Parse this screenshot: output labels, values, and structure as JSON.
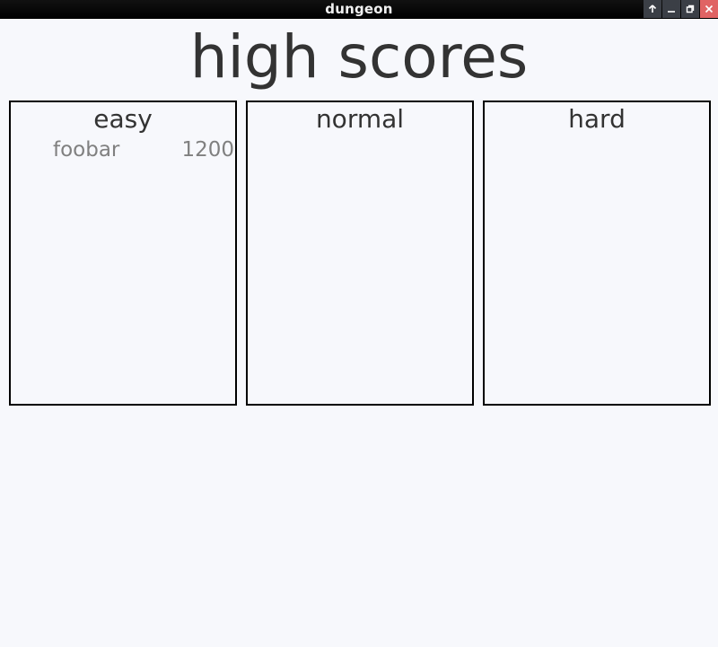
{
  "window": {
    "title": "dungeon",
    "buttons": [
      {
        "name": "raise",
        "icon": "arrow-up-icon"
      },
      {
        "name": "minimize",
        "icon": "minimize-icon"
      },
      {
        "name": "maximize",
        "icon": "restore-icon"
      },
      {
        "name": "close",
        "icon": "close-icon"
      }
    ],
    "close_color": "#e06464"
  },
  "heading": "high scores",
  "panels": [
    {
      "title": "easy",
      "scores": [
        {
          "name": "foobar",
          "score": "1200"
        }
      ]
    },
    {
      "title": "normal",
      "scores": []
    },
    {
      "title": "hard",
      "scores": []
    }
  ],
  "colors": {
    "background": "#f7f8fc",
    "heading_text": "#333333",
    "score_text": "#808080",
    "panel_border": "#000000"
  }
}
